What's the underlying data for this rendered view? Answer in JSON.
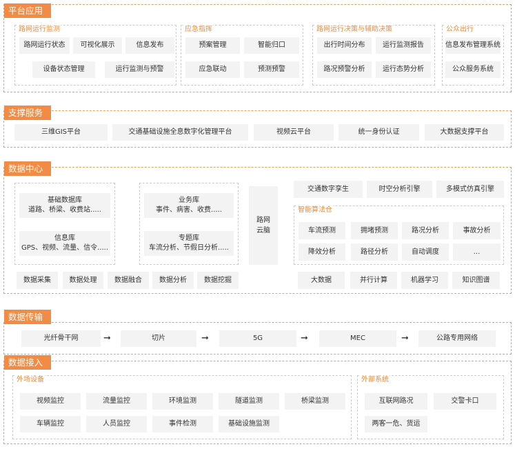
{
  "sections": {
    "platform": "平台应用",
    "support": "支撑服务",
    "datacenter": "数据中心",
    "transmission": "数据传输",
    "access": "数据接入"
  },
  "platform": {
    "road_monitor": {
      "title": "路网运行监测",
      "items": [
        "路网运行状态",
        "可视化展示",
        "信息发布",
        "设备状态管理",
        "运行监测与预警"
      ]
    },
    "emergency": {
      "title": "应急指挥",
      "items": [
        "预案管理",
        "智能归口",
        "应急联动",
        "预测预警"
      ]
    },
    "decision": {
      "title": "路网运行决策与辅助决策",
      "items": [
        "出行时间分布",
        "运行监测报告",
        "路况预警分析",
        "运行态势分析"
      ]
    },
    "public": {
      "title": "公众出行",
      "items": [
        "信息发布管理系统",
        "公众服务系统"
      ]
    }
  },
  "support": {
    "items": [
      "三维GIS平台",
      "交通基础设施全息数字化管理平台",
      "视频云平台",
      "统一身份认证",
      "大数据支撑平台"
    ]
  },
  "datacenter": {
    "basic_db": {
      "name": "基础数据库",
      "desc": "道路、桥梁、收费站....."
    },
    "info_db": {
      "name": "信息库",
      "desc": "GPS、视频、流量、信令....."
    },
    "biz_db": {
      "name": "业务库",
      "desc": "事件、病害、收费....."
    },
    "topic_db": {
      "name": "专题库",
      "desc": "车流分析、节假日分析....."
    },
    "brain": "路网云脑",
    "top_items": [
      "交通数字孪生",
      "时空分析引擎",
      "多模式仿真引擎"
    ],
    "algo": {
      "title": "智能算法仓",
      "items": [
        "车流预测",
        "拥堵预测",
        "路况分析",
        "事故分析",
        "降效分析",
        "路径分析",
        "自动调度",
        "..."
      ]
    },
    "process": [
      "数据采集",
      "数据处理",
      "数据融合",
      "数据分析",
      "数据挖掘"
    ],
    "tech": [
      "大数据",
      "并行计算",
      "机器学习",
      "知识图谱"
    ]
  },
  "transmission": {
    "items": [
      "光纤骨干网",
      "切片",
      "5G",
      "MEC",
      "公路专用网络"
    ],
    "arrow": "➞"
  },
  "access": {
    "field": {
      "title": "外场设备",
      "items": [
        "视频监控",
        "流量监控",
        "环境监测",
        "隧道监测",
        "桥梁监测",
        "车辆监控",
        "人员监控",
        "事件检测",
        "基础设施监测"
      ]
    },
    "external": {
      "title": "外部系统",
      "items": [
        "互联网路况",
        "交警卡口",
        "两客一危、货运"
      ]
    }
  },
  "colors": {
    "accent": "#f28c45",
    "dashed": "#f0a060",
    "box": "#f3f3f3"
  }
}
